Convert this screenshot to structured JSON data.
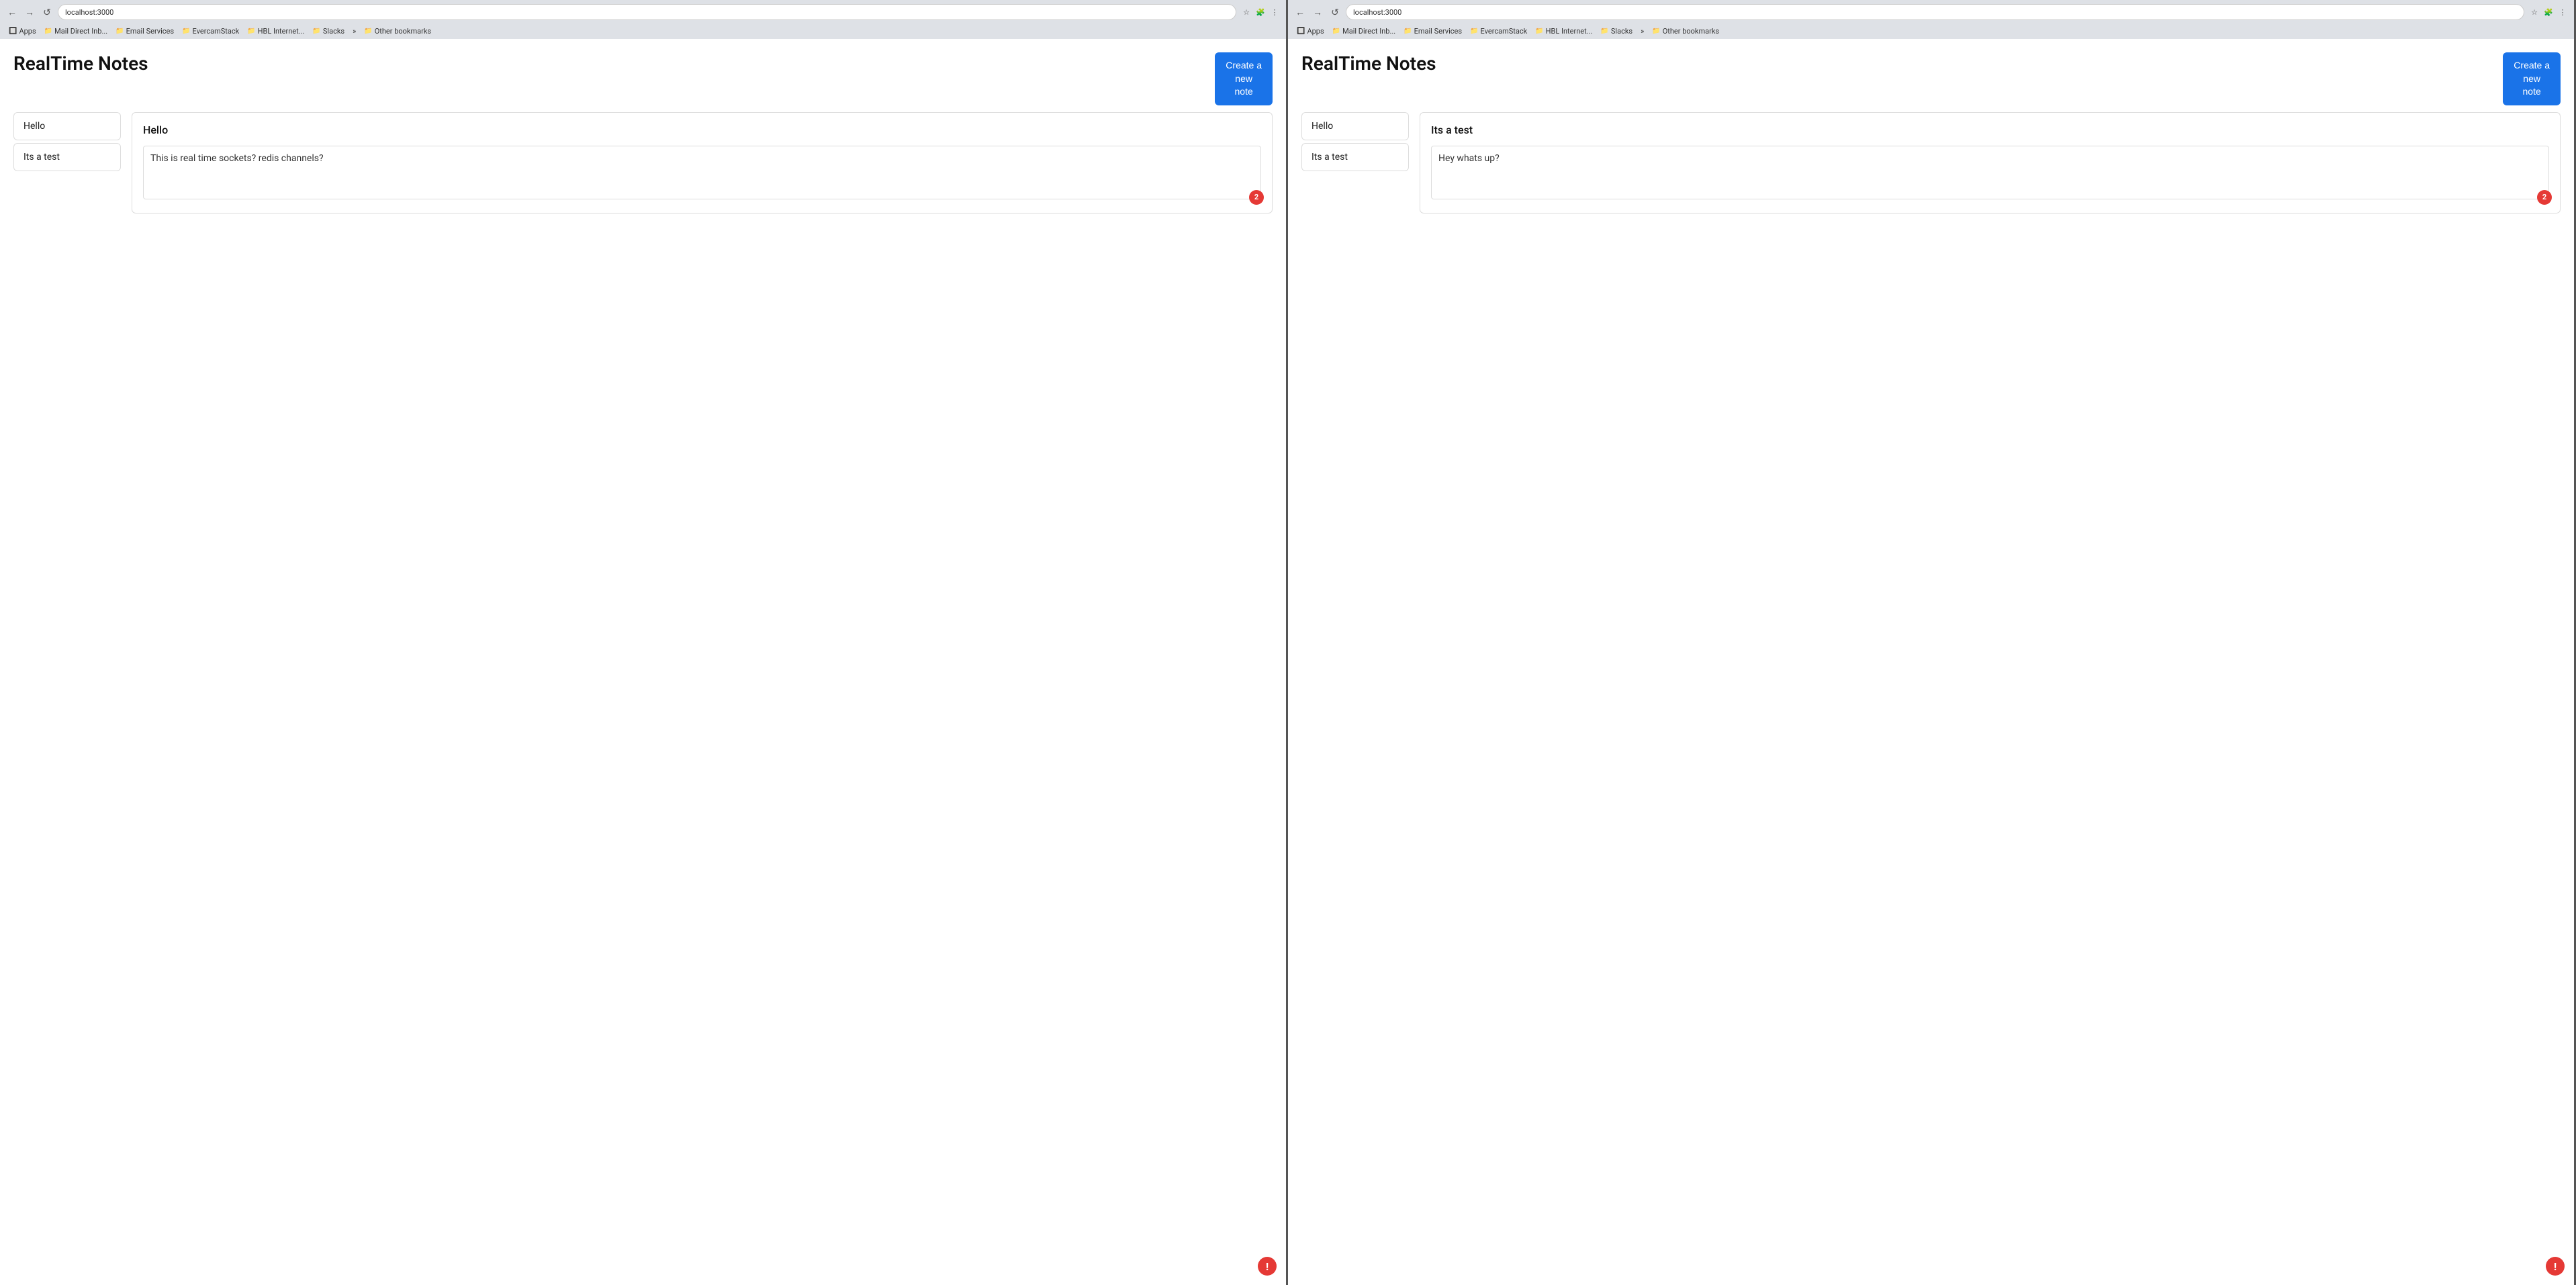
{
  "windows": [
    {
      "id": "window-left",
      "address": "localhost:3000",
      "app_title": "RealTime Notes",
      "create_btn_label": "Create a\nnew\nnote",
      "bookmarks": [
        {
          "label": "Apps",
          "icon": "🔲"
        },
        {
          "label": "Mail Direct Inb...",
          "icon": "📁"
        },
        {
          "label": "Email Services",
          "icon": "📁"
        },
        {
          "label": "EvercamStack",
          "icon": "📁"
        },
        {
          "label": "HBL Internet...",
          "icon": "📁"
        },
        {
          "label": "Slacks",
          "icon": "📁"
        },
        {
          "label": "»"
        },
        {
          "label": "Other bookmarks",
          "icon": "📁"
        }
      ],
      "note_list": [
        {
          "title": "Hello"
        },
        {
          "title": "Its a test"
        }
      ],
      "active_note": {
        "title": "Hello",
        "content": "This is real time sockets? redis channels?",
        "user_count": "2"
      },
      "bottom_icon": "!"
    },
    {
      "id": "window-right",
      "address": "localhost:3000",
      "app_title": "RealTime Notes",
      "create_btn_label": "Create a\nnew\nnote",
      "bookmarks": [
        {
          "label": "Apps",
          "icon": "🔲"
        },
        {
          "label": "Mail Direct Inb...",
          "icon": "📁"
        },
        {
          "label": "Email Services",
          "icon": "📁"
        },
        {
          "label": "EvercamStack",
          "icon": "📁"
        },
        {
          "label": "HBL Internet...",
          "icon": "📁"
        },
        {
          "label": "Slacks",
          "icon": "📁"
        },
        {
          "label": "»"
        },
        {
          "label": "Other bookmarks",
          "icon": "📁"
        }
      ],
      "note_list": [
        {
          "title": "Hello"
        },
        {
          "title": "Its a test"
        }
      ],
      "active_note": {
        "title": "Its a test",
        "content": "Hey whats up?",
        "user_count": "2"
      },
      "bottom_icon": "!"
    }
  ],
  "nav": {
    "back_label": "←",
    "forward_label": "→",
    "reload_label": "↺"
  }
}
